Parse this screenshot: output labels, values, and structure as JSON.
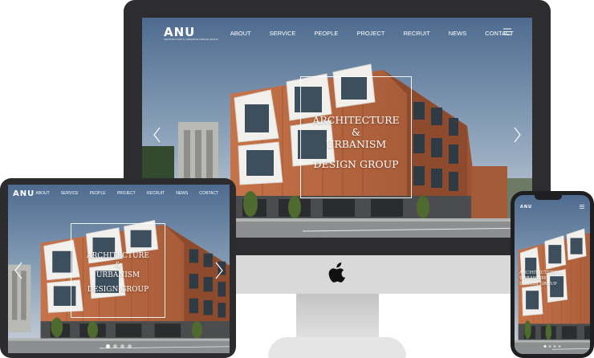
{
  "site": {
    "logo": "ANU",
    "logo_tagline": "ARCHITECTURE & URBANISM DESIGN GROUP",
    "nav": [
      "ABOUT",
      "SERVICE",
      "PEOPLE",
      "PROJECT",
      "RECRUIT",
      "NEWS",
      "CONTACT"
    ],
    "hero": {
      "line1": "ARCHITECTURE",
      "line2": "&",
      "line3": "URBANISM",
      "line4": "DESIGN GROUP"
    },
    "phone_hero": "ARCHITECTURE & URBANISM\nDESIGN GROUP"
  },
  "colors": {
    "sky": "#6f89a6",
    "facade_wood": "#b3653f",
    "frame_dark": "#2d2d2f",
    "stand_silver": "#d9d9d9"
  },
  "icons": [
    "menu-icon",
    "arrow-left-icon",
    "arrow-right-icon",
    "apple-logo-icon"
  ]
}
